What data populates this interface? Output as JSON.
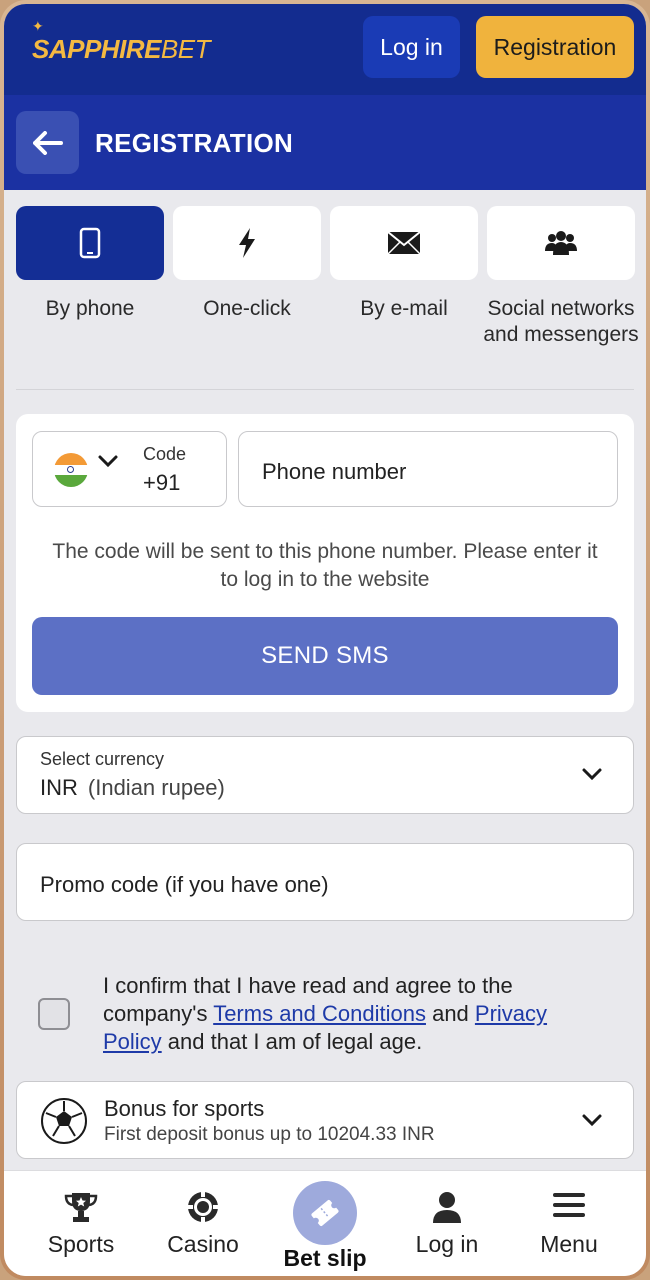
{
  "header": {
    "logo_bold": "SAPPHIRE",
    "logo_light": "BET",
    "login_label": "Log in",
    "registration_label": "Registration"
  },
  "page": {
    "title": "REGISTRATION"
  },
  "methods": [
    {
      "label": "By phone",
      "icon": "phone-icon",
      "active": true
    },
    {
      "label": "One-click",
      "icon": "lightning-icon",
      "active": false
    },
    {
      "label": "By e-mail",
      "icon": "envelope-icon",
      "active": false
    },
    {
      "label": "Social networks and messengers",
      "icon": "users-icon",
      "active": false
    }
  ],
  "phone_form": {
    "code_label": "Code",
    "code_value": "+91",
    "country_flag": "india-flag",
    "phone_placeholder": "Phone number",
    "hint": "The code will be sent to this phone number. Please enter it to log in to the website",
    "send_label": "SEND SMS"
  },
  "currency": {
    "label": "Select currency",
    "code": "INR",
    "name": "(Indian rupee)"
  },
  "promo": {
    "placeholder": "Promo code (if you have one)"
  },
  "consent": {
    "text_1": "I confirm that I have read and agree to the company's ",
    "terms_link": "Terms and Conditions",
    "text_2": " and ",
    "privacy_link": "Privacy Policy",
    "text_3": " and that I am of legal age.",
    "checked": false
  },
  "bonus": {
    "title": "Bonus for sports",
    "subtitle": "First deposit bonus up to 10204.33 INR"
  },
  "bottom_nav": [
    {
      "label": "Sports",
      "icon": "trophy-icon"
    },
    {
      "label": "Casino",
      "icon": "casino-chip-icon"
    },
    {
      "label": "Bet slip",
      "icon": "ticket-icon"
    },
    {
      "label": "Log in",
      "icon": "user-icon"
    },
    {
      "label": "Menu",
      "icon": "menu-icon"
    }
  ],
  "colors": {
    "brand_navy": "#132c8f",
    "title_bar": "#1b31a2",
    "accent_gold": "#f0b33d",
    "send_button": "#5c70c5",
    "link": "#1e3aa8"
  }
}
